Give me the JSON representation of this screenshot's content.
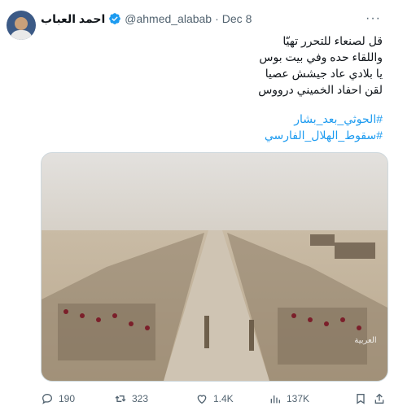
{
  "tweet": {
    "author_name": "احمد العباب",
    "handle": "@ahmed_alabab",
    "separator": "·",
    "date": "Dec 8",
    "more_label": "···",
    "lines": [
      "قل لصنعاء للتحرر تهيّا",
      "واللقاء حده وفي بيت بوس",
      "يا بلادي عاد جيشش عصيا",
      "لقن احفاد الخميني درووس"
    ],
    "hashtags": [
      "#الحوثي_بعد_بشار",
      "#سقوط_الهلال_الفارسي"
    ],
    "media_watermark": "العربية"
  },
  "actions": {
    "replies": "190",
    "reposts": "323",
    "likes": "1.4K",
    "views": "137K"
  },
  "colors": {
    "link": "#1d9bf0",
    "secondary_text": "#536471",
    "verified": "#1d9bf0"
  }
}
